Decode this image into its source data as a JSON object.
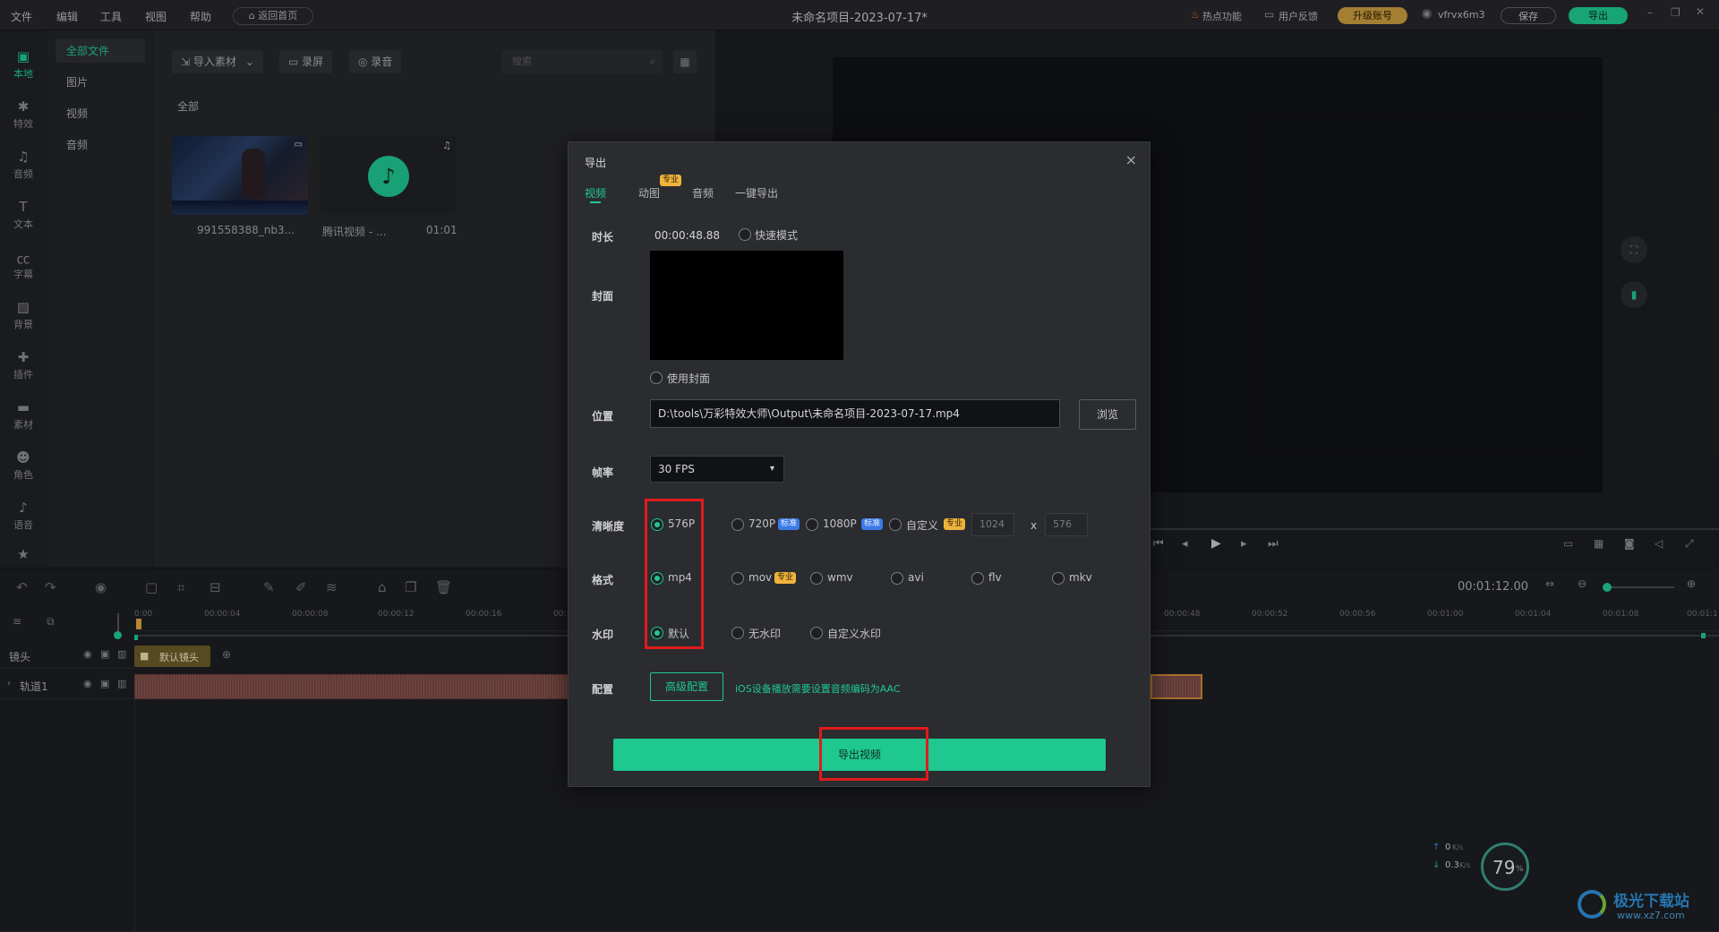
{
  "menu": [
    "文件",
    "编辑",
    "工具",
    "视图",
    "帮助"
  ],
  "home_button": "返回首页",
  "project_title": "未命名项目-2023-07-17*",
  "top_right": {
    "hot": "热点功能",
    "feedback": "用户反馈",
    "upgrade": "升级账号",
    "username": "vfrvx6m3",
    "save": "保存",
    "export": "导出"
  },
  "icon_nav": [
    {
      "label": "本地",
      "icon": "folder-icon"
    },
    {
      "label": "特效",
      "icon": "effects-icon"
    },
    {
      "label": "音频",
      "icon": "music-note-icon"
    },
    {
      "label": "文本",
      "icon": "text-icon"
    },
    {
      "label": "字幕",
      "icon": "subtitle-icon"
    },
    {
      "label": "背景",
      "icon": "background-icon"
    },
    {
      "label": "插件",
      "icon": "puzzle-icon"
    },
    {
      "label": "素材",
      "icon": "folder-icon"
    },
    {
      "label": "角色",
      "icon": "person-icon"
    },
    {
      "label": "语音",
      "icon": "voice-icon"
    }
  ],
  "categories": [
    "全部文件",
    "图片",
    "视频",
    "音频"
  ],
  "media_toolbar": {
    "import": "导入素材",
    "record_screen": "录屏",
    "record_audio": "录音",
    "search_placeholder": "搜索"
  },
  "media_section": "全部",
  "media_items": [
    {
      "name": "991558388_nb3...",
      "duration": ""
    },
    {
      "name": "腾讯视频 - ...",
      "duration": "01:01"
    }
  ],
  "timeline": {
    "time_display": "00:01:12.00",
    "ruler_left": [
      "0:00",
      "00:00:04",
      "00:00:08",
      "00:00:12",
      "00:00:16",
      "00:"
    ],
    "ruler_right": [
      "00:00:48",
      "00:00:52",
      "00:00:56",
      "00:01:00",
      "00:01:04",
      "00:01:08",
      "00:01:1"
    ],
    "track_camera": "镜头",
    "track_camera_clip": "默认镜头",
    "track_1": "轨道1"
  },
  "net": {
    "up": "0",
    "down": "0.3",
    "unit": "K/s",
    "percent": "79",
    "percent_unit": "%"
  },
  "watermark_brand": "极光下载站",
  "watermark_url": "www.xz7.com",
  "dialog": {
    "title": "导出",
    "tabs": [
      "视频",
      "动图",
      "音频",
      "一键导出"
    ],
    "tab_badge": "专业",
    "duration_label": "时长",
    "duration_value": "00:00:48.88",
    "fast_mode": "快速模式",
    "cover_label": "封面",
    "use_cover": "使用封面",
    "location_label": "位置",
    "location_value": "D:\\tools\\万彩特效大师\\Output\\未命名项目-2023-07-17.mp4",
    "browse": "浏览",
    "fps_label": "帧率",
    "fps_value": "30 FPS",
    "res_label": "清晰度",
    "res_options": [
      "576P",
      "720P",
      "1080P",
      "自定义"
    ],
    "res_badges": [
      "",
      "标准",
      "标准",
      "专业"
    ],
    "res_width": "1024",
    "res_x": "x",
    "res_height": "576",
    "format_label": "格式",
    "format_options": [
      "mp4",
      "mov",
      "wmv",
      "avi",
      "flv",
      "mkv"
    ],
    "format_badge": "专业",
    "watermark_label": "水印",
    "watermark_options": [
      "默认",
      "无水印",
      "自定义水印"
    ],
    "config_label": "配置",
    "advanced": "高级配置",
    "ios_tip": "iOS设备播放需要设置音频编码为AAC",
    "export_video": "导出视频"
  }
}
